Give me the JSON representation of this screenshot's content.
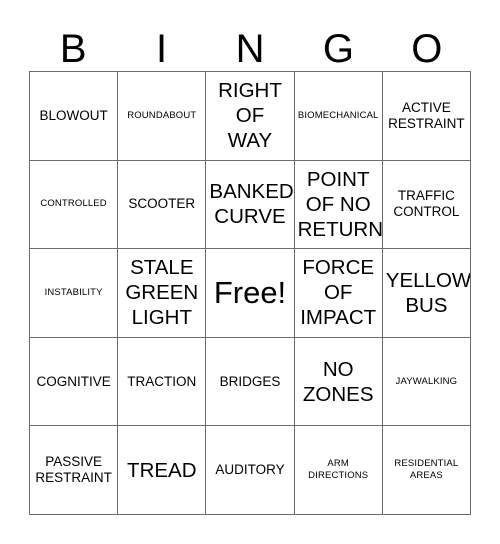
{
  "card": {
    "header_letters": [
      "B",
      "I",
      "N",
      "G",
      "O"
    ],
    "colors": {
      "background": "#ffffff",
      "text": "#000000",
      "grid_line": "#6b6b6b"
    },
    "rows": [
      [
        {
          "text": "BLOWOUT",
          "size": "sm"
        },
        {
          "text": "ROUNDABOUT",
          "size": "xs"
        },
        {
          "text": "RIGHT\nOF\nWAY",
          "size": "lg"
        },
        {
          "text": "BIOMECHANICAL",
          "size": "xs"
        },
        {
          "text": "ACTIVE\nRESTRAINT",
          "size": "sm"
        }
      ],
      [
        {
          "text": "CONTROLLED",
          "size": "xs"
        },
        {
          "text": "SCOOTER",
          "size": "sm"
        },
        {
          "text": "BANKED\nCURVE",
          "size": "lg"
        },
        {
          "text": "POINT\nOF NO\nRETURN",
          "size": "lg"
        },
        {
          "text": "TRAFFIC\nCONTROL",
          "size": "sm"
        }
      ],
      [
        {
          "text": "INSTABILITY",
          "size": "xs"
        },
        {
          "text": "STALE\nGREEN\nLIGHT",
          "size": "lg"
        },
        {
          "text": "Free!",
          "size": "xl"
        },
        {
          "text": "FORCE\nOF\nIMPACT",
          "size": "lg"
        },
        {
          "text": "YELLOW\nBUS",
          "size": "lg"
        }
      ],
      [
        {
          "text": "COGNITIVE",
          "size": "sm"
        },
        {
          "text": "TRACTION",
          "size": "sm"
        },
        {
          "text": "BRIDGES",
          "size": "sm"
        },
        {
          "text": "NO\nZONES",
          "size": "lg"
        },
        {
          "text": "JAYWALKING",
          "size": "xs"
        }
      ],
      [
        {
          "text": "PASSIVE\nRESTRAINT",
          "size": "sm"
        },
        {
          "text": "TREAD",
          "size": "lg"
        },
        {
          "text": "AUDITORY",
          "size": "sm"
        },
        {
          "text": "ARM\nDIRECTIONS",
          "size": "xs"
        },
        {
          "text": "RESIDENTIAL\nAREAS",
          "size": "xs"
        }
      ]
    ]
  }
}
